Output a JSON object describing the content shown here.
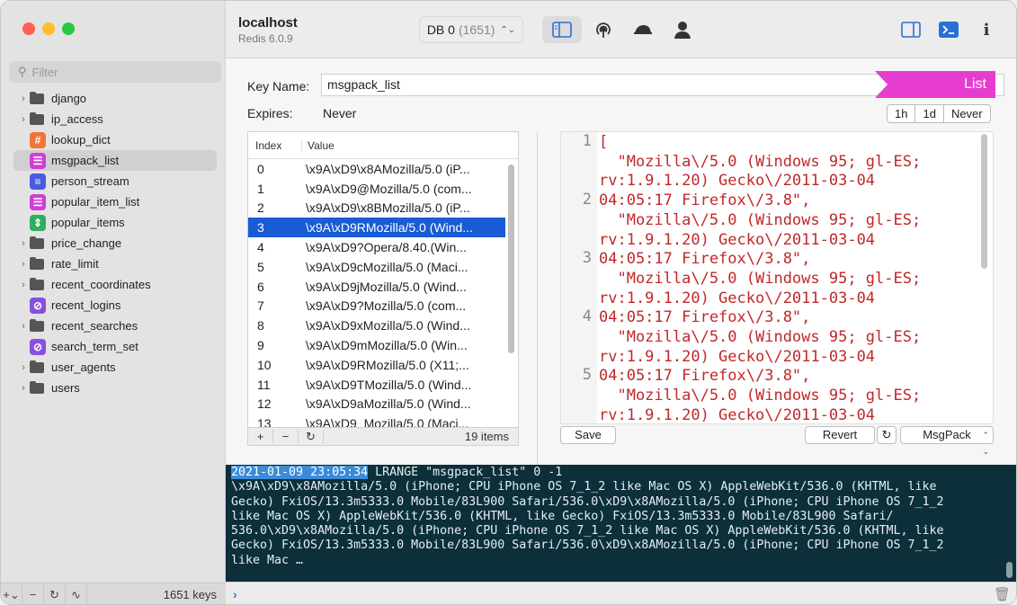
{
  "sidebar": {
    "filter_placeholder": "Filter",
    "items": [
      {
        "label": "django",
        "kind": "folder"
      },
      {
        "label": "ip_access",
        "kind": "folder"
      },
      {
        "label": "lookup_dict",
        "kind": "hash",
        "glyph": "#"
      },
      {
        "label": "msgpack_list",
        "kind": "list",
        "glyph": "☰"
      },
      {
        "label": "person_stream",
        "kind": "stream",
        "glyph": "≡"
      },
      {
        "label": "popular_item_list",
        "kind": "list",
        "glyph": "☰"
      },
      {
        "label": "popular_items",
        "kind": "zset",
        "glyph": "⇕"
      },
      {
        "label": "price_change",
        "kind": "folder"
      },
      {
        "label": "rate_limit",
        "kind": "folder"
      },
      {
        "label": "recent_coordinates",
        "kind": "folder"
      },
      {
        "label": "recent_logins",
        "kind": "set",
        "glyph": "⊘"
      },
      {
        "label": "recent_searches",
        "kind": "folder"
      },
      {
        "label": "search_term_set",
        "kind": "set",
        "glyph": "⊘"
      },
      {
        "label": "user_agents",
        "kind": "folder"
      },
      {
        "label": "users",
        "kind": "folder"
      }
    ],
    "key_count": "1651 keys"
  },
  "toolbar": {
    "host": "localhost",
    "version": "Redis 6.0.9",
    "db_label": "DB 0",
    "db_count": "(1651)"
  },
  "key": {
    "name_label": "Key Name:",
    "name_value": "msgpack_list",
    "type": "List",
    "expires_label": "Expires:",
    "expires_value": "Never",
    "ttl_options": [
      "1h",
      "1d",
      "Never"
    ]
  },
  "list": {
    "headers": {
      "index": "Index",
      "value": "Value"
    },
    "rows": [
      {
        "i": "0",
        "v": "\\x9A\\xD9\\x8AMozilla/5.0 (iP..."
      },
      {
        "i": "1",
        "v": "\\x9A\\xD9@Mozilla/5.0 (com..."
      },
      {
        "i": "2",
        "v": "\\x9A\\xD9\\x8BMozilla/5.0 (iP..."
      },
      {
        "i": "3",
        "v": "\\x9A\\xD9RMozilla/5.0 (Wind..."
      },
      {
        "i": "4",
        "v": "\\x9A\\xD9?Opera/8.40.(Win..."
      },
      {
        "i": "5",
        "v": "\\x9A\\xD9cMozilla/5.0 (Maci..."
      },
      {
        "i": "6",
        "v": "\\x9A\\xD9jMozilla/5.0 (Wind..."
      },
      {
        "i": "7",
        "v": "\\x9A\\xD9?Mozilla/5.0 (com..."
      },
      {
        "i": "8",
        "v": "\\x9A\\xD9xMozilla/5.0 (Wind..."
      },
      {
        "i": "9",
        "v": "\\x9A\\xD9mMozilla/5.0 (Win..."
      },
      {
        "i": "10",
        "v": "\\x9A\\xD9RMozilla/5.0 (X11;..."
      },
      {
        "i": "11",
        "v": "\\x9A\\xD9TMozilla/5.0 (Wind..."
      },
      {
        "i": "12",
        "v": "\\x9A\\xD9aMozilla/5.0 (Wind..."
      },
      {
        "i": "13",
        "v": "\\x9A\\xD9_Mozilla/5.0 (Maci..."
      }
    ],
    "selected_index": 3,
    "item_count": "19 items"
  },
  "editor": {
    "line_numbers": [
      "1",
      "2",
      "3",
      "4",
      "5"
    ],
    "lines": [
      "[",
      "  \"Mozilla\\/5.0 (Windows 95; gl-ES;",
      "rv:1.9.1.20) Gecko\\/2011-03-04",
      "04:05:17 Firefox\\/3.8\",",
      "  \"Mozilla\\/5.0 (Windows 95; gl-ES;",
      "rv:1.9.1.20) Gecko\\/2011-03-04",
      "04:05:17 Firefox\\/3.8\",",
      "  \"Mozilla\\/5.0 (Windows 95; gl-ES;",
      "rv:1.9.1.20) Gecko\\/2011-03-04",
      "04:05:17 Firefox\\/3.8\",",
      "  \"Mozilla\\/5.0 (Windows 95; gl-ES;",
      "rv:1.9.1.20) Gecko\\/2011-03-04",
      "04:05:17 Firefox\\/3.8\",",
      "  \"Mozilla\\/5.0 (Windows 95; gl-ES;",
      "rv:1.9.1.20) Gecko\\/2011-03-04"
    ],
    "save_label": "Save",
    "revert_label": "Revert",
    "format_label": "MsgPack"
  },
  "console": {
    "timestamp": "2021-01-09 23:05:34",
    "command": " LRANGE \"msgpack_list\" 0 -1",
    "output": [
      "\\x9A\\xD9\\x8AMozilla/5.0 (iPhone; CPU iPhone OS 7_1_2 like Mac OS X) AppleWebKit/536.0 (KHTML, like",
      "Gecko) FxiOS/13.3m5333.0 Mobile/83L900 Safari/536.0\\xD9\\x8AMozilla/5.0 (iPhone; CPU iPhone OS 7_1_2",
      "like Mac OS X) AppleWebKit/536.0 (KHTML, like Gecko) FxiOS/13.3m5333.0 Mobile/83L900 Safari/",
      "536.0\\xD9\\x8AMozilla/5.0 (iPhone; CPU iPhone OS 7_1_2 like Mac OS X) AppleWebKit/536.0 (KHTML, like",
      "Gecko) FxiOS/13.3m5333.0 Mobile/83L900 Safari/536.0\\xD9\\x8AMozilla/5.0 (iPhone; CPU iPhone OS 7_1_2",
      "like Mac …"
    ]
  }
}
